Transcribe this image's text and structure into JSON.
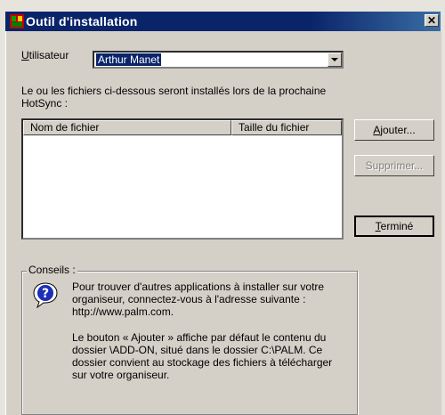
{
  "window": {
    "title": "Outil d'installation",
    "close_glyph": "✕"
  },
  "user": {
    "label": "Utilisateur",
    "selected": "Arthur Manet"
  },
  "instructions": "Le ou les fichiers ci-dessous seront installés lors de la prochaine HotSync :",
  "file_list": {
    "columns": [
      "Nom de fichier",
      "Taille du fichier"
    ],
    "rows": []
  },
  "buttons": {
    "add": "Ajouter...",
    "remove": "Supprimer...",
    "done": "Terminé"
  },
  "tips": {
    "legend": "Conseils :",
    "paragraph1": "Pour trouver d'autres applications à installer sur votre organiseur, connectez-vous à l'adresse suivante : http://www.palm.com.",
    "paragraph2": "Le bouton « Ajouter » affiche par défaut le contenu du dossier \\ADD-ON, situé dans le dossier C:\\PALM. Ce dossier convient au stockage des fichiers à télécharger sur votre organiseur."
  },
  "colors": {
    "title_bar": "#0a246a",
    "face": "#d4d0c8",
    "selection": "#0a246a"
  },
  "icons": {
    "app": "palm-install-icon",
    "help": "question-balloon-icon",
    "dropdown": "dropdown-arrow-icon"
  }
}
